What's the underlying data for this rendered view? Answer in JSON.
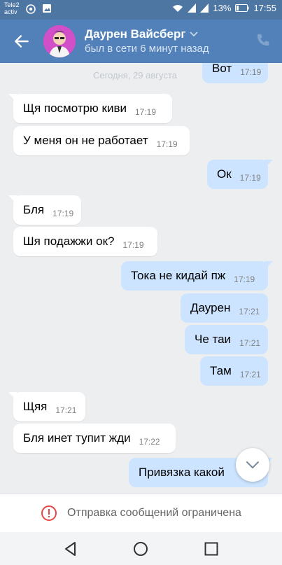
{
  "status_bar": {
    "carrier_line1": "Tele2",
    "carrier_line2": "activ",
    "battery": "13%",
    "time": "17:55"
  },
  "header": {
    "name": "Даурен Вайсберг",
    "status": "был в сети 6 минут назад"
  },
  "chat": {
    "date_separator": "Сегодня, 29 августа",
    "messages": [
      {
        "text": "Вот",
        "time": "17:19"
      },
      {
        "text": "Щя посмотрю киви",
        "time": "17:19"
      },
      {
        "text": "У меня он не работает",
        "time": "17:19"
      },
      {
        "text": "Ок",
        "time": "17:19"
      },
      {
        "text": "Бля",
        "time": "17:19"
      },
      {
        "text": "Шя подажжи ок?",
        "time": "17:19"
      },
      {
        "text": "Тока не кидай пж",
        "time": "17:19"
      },
      {
        "text": "Даурен",
        "time": "17:21"
      },
      {
        "text": "Че таи",
        "time": "17:21"
      },
      {
        "text": "Там",
        "time": "17:21"
      },
      {
        "text": "Щяя",
        "time": "17:21"
      },
      {
        "text": "Бля инет  тупит жди",
        "time": "17:22"
      },
      {
        "text": "Привязка какой",
        "time": ""
      }
    ]
  },
  "restriction": {
    "text": "Отправка сообщений ограничена"
  },
  "colors": {
    "header": "#5181b8",
    "outgoing_bubble": "#cce4ff",
    "incoming_bubble": "#ffffff",
    "chat_bg": "#edeef0",
    "warning": "#e64646"
  }
}
